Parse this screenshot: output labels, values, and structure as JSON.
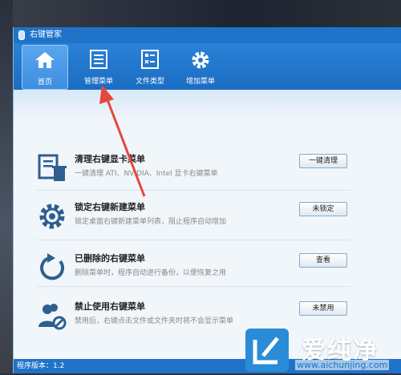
{
  "window": {
    "title": "右键管家"
  },
  "toolbar": {
    "items": [
      {
        "label": "首页",
        "icon": "home-icon",
        "active": true
      },
      {
        "label": "管理菜单",
        "icon": "list-icon",
        "active": false
      },
      {
        "label": "文件类型",
        "icon": "file-type-icon",
        "active": false
      },
      {
        "label": "增加菜单",
        "icon": "gear-icon",
        "active": false
      }
    ]
  },
  "rows": [
    {
      "title": "清理右键显卡菜单",
      "desc": "一键清理 ATI、NVIDIA、Intel 显卡右键菜单",
      "button": "一键清理",
      "icon": "clean-menu-icon"
    },
    {
      "title": "锁定右键新建菜单",
      "desc": "锁定桌面右键新建菜单列表，阻止程序自动增加",
      "button": "未锁定",
      "icon": "gear-icon"
    },
    {
      "title": "已删除的右键菜单",
      "desc": "删除菜单时，程序自动进行备份，以便恢复之用",
      "button": "查看",
      "icon": "restore-icon"
    },
    {
      "title": "禁止使用右键菜单",
      "desc": "禁用后，右键点击文件或文件夹时将不会显示菜单",
      "button": "未禁用",
      "icon": "user-block-icon"
    }
  ],
  "status": {
    "version": "程序版本：1.2"
  },
  "watermark": {
    "brand": "爱纯净",
    "url": "www.aichunjing.com"
  },
  "colors": {
    "accent": "#1f73c9",
    "arrow": "#e8473b"
  }
}
